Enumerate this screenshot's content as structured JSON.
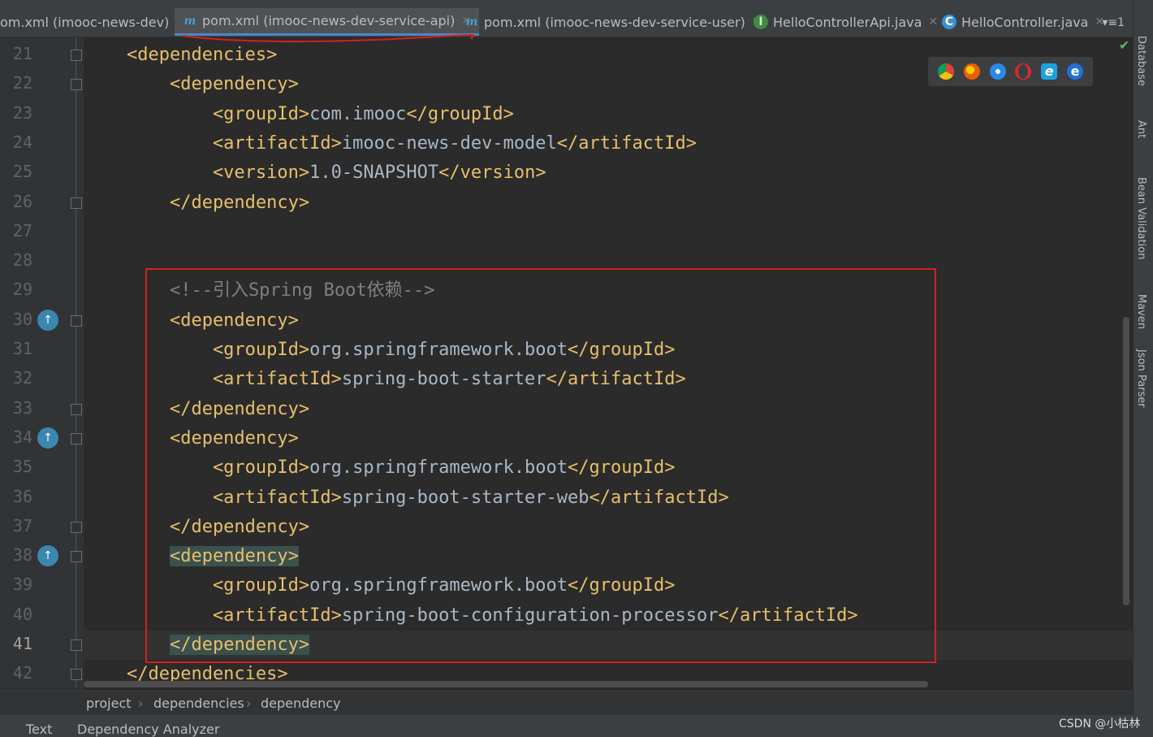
{
  "tabs": [
    {
      "label": "om.xml (imooc-news-dev)",
      "icon": "none"
    },
    {
      "label": "pom.xml (imooc-news-dev-service-api)",
      "icon": "maven-m-icon",
      "active": true
    },
    {
      "label": "pom.xml (imooc-news-dev-service-user)",
      "icon": "maven-m-icon"
    },
    {
      "label": "HelloControllerApi.java",
      "icon": "interface-icon"
    },
    {
      "label": "HelloController.java",
      "icon": "class-icon"
    }
  ],
  "tab_menu": "▾≡1",
  "gutter": {
    "lines": [
      "21",
      "22",
      "23",
      "24",
      "25",
      "26",
      "27",
      "28",
      "29",
      "30",
      "31",
      "32",
      "33",
      "34",
      "35",
      "36",
      "37",
      "38",
      "39",
      "40",
      "41",
      "42"
    ],
    "current_line": "41"
  },
  "code": [
    {
      "n": "21",
      "segs": [
        [
          "tag",
          "    <dependencies>"
        ]
      ]
    },
    {
      "n": "22",
      "segs": [
        [
          "tag",
          "        <dependency>"
        ]
      ]
    },
    {
      "n": "23",
      "segs": [
        [
          "tag",
          "            <groupId>"
        ],
        [
          "txt",
          "com.imooc"
        ],
        [
          "tag",
          "</groupId>"
        ]
      ]
    },
    {
      "n": "24",
      "segs": [
        [
          "tag",
          "            <artifactId>"
        ],
        [
          "txt",
          "imooc-news-dev-model"
        ],
        [
          "tag",
          "</artifactId>"
        ]
      ]
    },
    {
      "n": "25",
      "segs": [
        [
          "tag",
          "            <version>"
        ],
        [
          "txt",
          "1.0-SNAPSHOT"
        ],
        [
          "tag",
          "</version>"
        ]
      ]
    },
    {
      "n": "26",
      "segs": [
        [
          "tag",
          "        </dependency>"
        ]
      ]
    },
    {
      "n": "27",
      "segs": []
    },
    {
      "n": "28",
      "segs": []
    },
    {
      "n": "29",
      "segs": [
        [
          "cmt",
          "        <!--引入Spring Boot依赖-->"
        ]
      ]
    },
    {
      "n": "30",
      "segs": [
        [
          "tag",
          "        <dependency>"
        ]
      ]
    },
    {
      "n": "31",
      "segs": [
        [
          "tag",
          "            <groupId>"
        ],
        [
          "txt",
          "org.springframework.boot"
        ],
        [
          "tag",
          "</groupId>"
        ]
      ]
    },
    {
      "n": "32",
      "segs": [
        [
          "tag",
          "            <artifactId>"
        ],
        [
          "txt",
          "spring-boot-starter"
        ],
        [
          "tag",
          "</artifactId>"
        ]
      ]
    },
    {
      "n": "33",
      "segs": [
        [
          "tag",
          "        </dependency>"
        ]
      ]
    },
    {
      "n": "34",
      "segs": [
        [
          "tag",
          "        <dependency>"
        ]
      ]
    },
    {
      "n": "35",
      "segs": [
        [
          "tag",
          "            <groupId>"
        ],
        [
          "txt",
          "org.springframework.boot"
        ],
        [
          "tag",
          "</groupId>"
        ]
      ]
    },
    {
      "n": "36",
      "segs": [
        [
          "tag",
          "            <artifactId>"
        ],
        [
          "txt",
          "spring-boot-starter-web"
        ],
        [
          "tag",
          "</artifactId>"
        ]
      ]
    },
    {
      "n": "37",
      "segs": [
        [
          "tag",
          "        </dependency>"
        ]
      ]
    },
    {
      "n": "38",
      "segs": [
        [
          "tag",
          "        "
        ],
        [
          "hl",
          "<dependency>"
        ]
      ]
    },
    {
      "n": "39",
      "segs": [
        [
          "tag",
          "            <groupId>"
        ],
        [
          "txt",
          "org.springframework.boot"
        ],
        [
          "tag",
          "</groupId>"
        ]
      ]
    },
    {
      "n": "40",
      "segs": [
        [
          "tag",
          "            <artifactId>"
        ],
        [
          "txt",
          "spring-boot-configuration-processor"
        ],
        [
          "tag",
          "</artifactId>"
        ]
      ]
    },
    {
      "n": "41",
      "segs": [
        [
          "tag",
          "        "
        ],
        [
          "hl",
          "</dependency>"
        ]
      ]
    },
    {
      "n": "42",
      "segs": [
        [
          "tag",
          "    </dependencies>"
        ]
      ]
    }
  ],
  "breadcrumb": [
    "project",
    "dependencies",
    "dependency"
  ],
  "right_tools": [
    "Database",
    "Ant",
    "Bean Validation",
    "Maven",
    "Json Parser"
  ],
  "bottom_tools": [
    "Text",
    "Dependency Analyzer"
  ],
  "watermark": "CSDN @小枯林",
  "browser_icons": [
    "chrome-icon",
    "firefox-icon",
    "safari-icon",
    "opera-icon",
    "ie-icon",
    "edge-icon"
  ],
  "colors": {
    "annotation": "#d42020",
    "tag": "#e8bf6a",
    "text": "#a9b7c6",
    "comment": "#808080"
  }
}
